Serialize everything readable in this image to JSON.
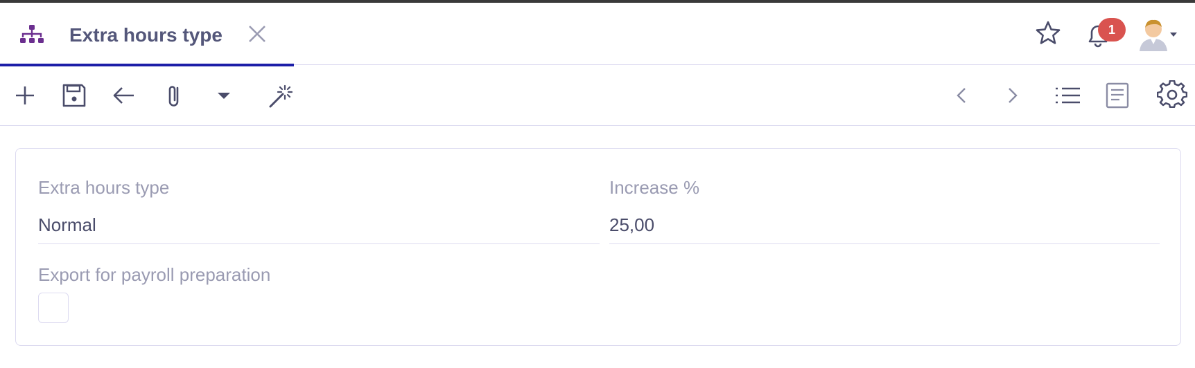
{
  "tab": {
    "title": "Extra hours type",
    "icon": "hierarchy-icon",
    "accent_color": "#1c1ea8",
    "icon_color": "#6b2f8f"
  },
  "header": {
    "notification_count": "1",
    "badge_color": "#d9534f"
  },
  "toolbar": {
    "left": [
      "plus-icon",
      "save-icon",
      "back-arrow-icon",
      "paperclip-icon",
      "caret-down-icon",
      "magic-wand-icon"
    ],
    "right": [
      "chevron-left-icon",
      "chevron-right-icon",
      "list-icon",
      "form-view-icon",
      "gear-icon"
    ]
  },
  "form": {
    "type_label": "Extra hours type",
    "type_value": "Normal",
    "increase_label": "Increase %",
    "increase_value": "25,00",
    "export_label": "Export for payroll preparation",
    "export_checked": false
  }
}
